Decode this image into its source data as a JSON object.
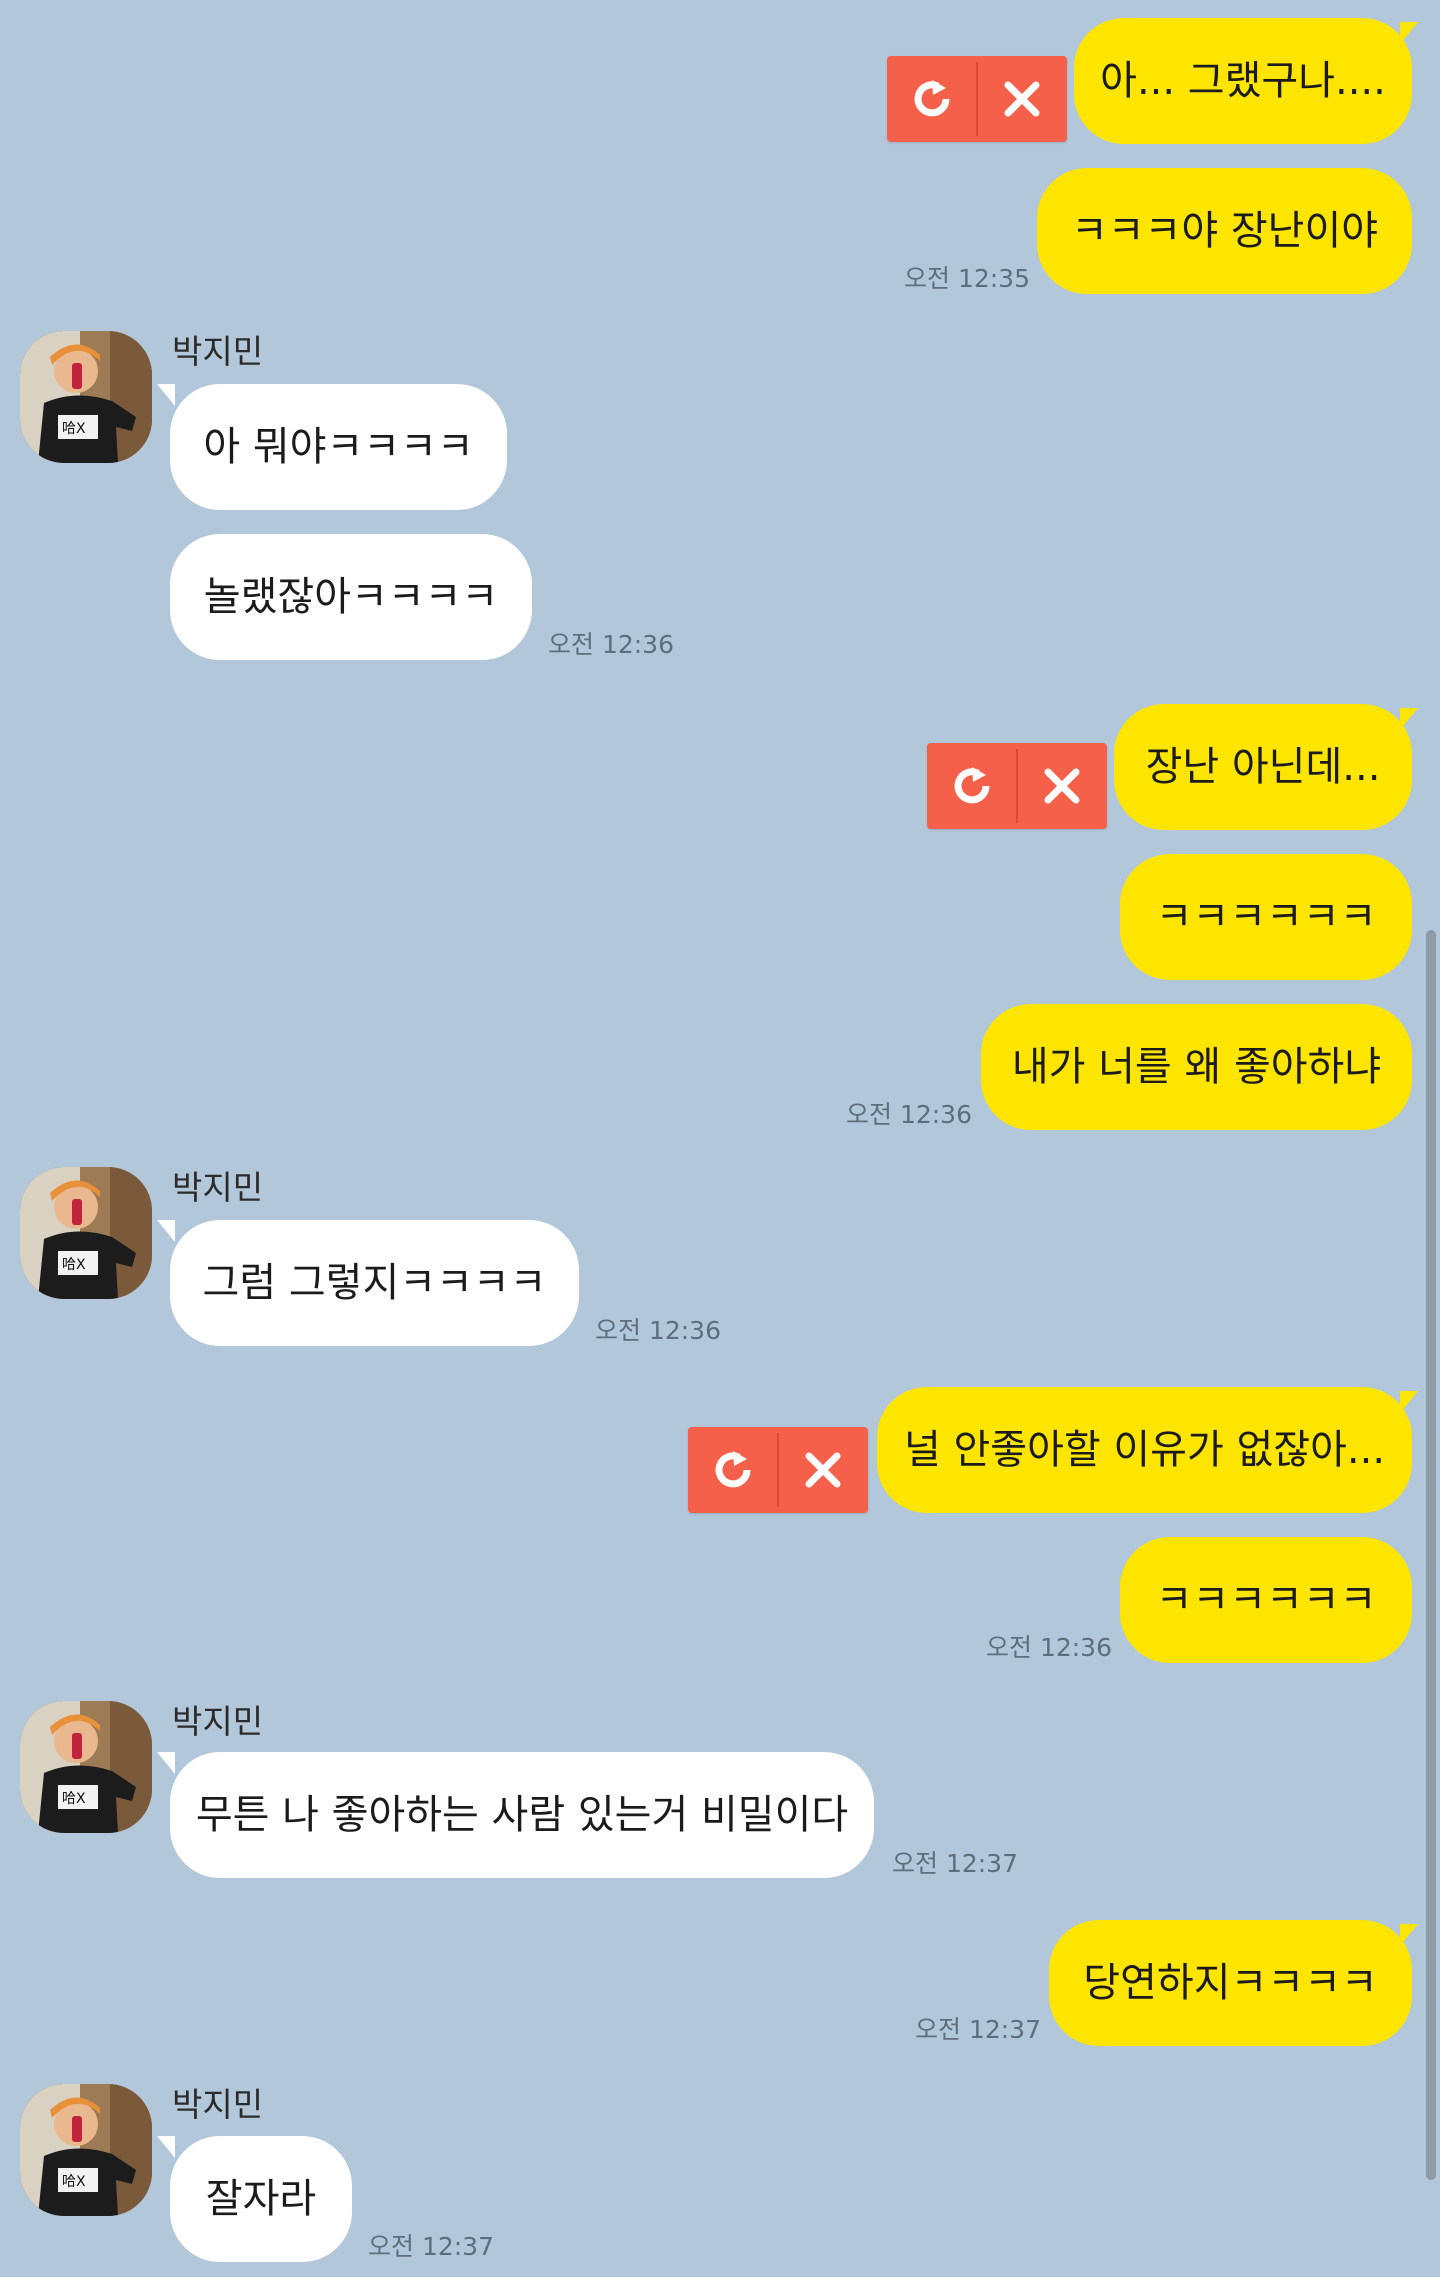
{
  "chat": {
    "friend_name": "박지민",
    "messages": [
      {
        "from": "me",
        "text": "아... 그랬구나...."
      },
      {
        "from": "me",
        "text": "ㅋㅋㅋ야 장난이야",
        "time": "오전 12:35"
      },
      {
        "from": "other",
        "text": "아 뭐야ㅋㅋㅋㅋ"
      },
      {
        "from": "other",
        "text": "놀랬잖아ㅋㅋㅋㅋ",
        "time": "오전 12:36"
      },
      {
        "from": "me",
        "text": "장난 아닌데..."
      },
      {
        "from": "me",
        "text": "ㅋㅋㅋㅋㅋㅋ"
      },
      {
        "from": "me",
        "text": "내가 너를 왜 좋아하냐",
        "time": "오전 12:36"
      },
      {
        "from": "other",
        "text": "그럼 그렇지ㅋㅋㅋㅋ",
        "time": "오전 12:36"
      },
      {
        "from": "me",
        "text": "널 안좋아할 이유가 없잖아..."
      },
      {
        "from": "me",
        "text": "ㅋㅋㅋㅋㅋㅋ",
        "time": "오전 12:36"
      },
      {
        "from": "other",
        "text": "무튼 나 좋아하는 사람 있는거 비밀이다",
        "time": "오전 12:37"
      },
      {
        "from": "me",
        "text": "당연하지ㅋㅋㅋㅋ",
        "time": "오전 12:37"
      },
      {
        "from": "other",
        "text": "잘자라",
        "time": "오전 12:37"
      }
    ]
  },
  "icons": {
    "retry": "retry-icon",
    "delete": "close-icon",
    "avatar": "profile-photo"
  },
  "colors": {
    "background": "#b2c7da",
    "my_bubble": "#fee500",
    "friend_bubble": "#ffffff",
    "failed_send": "#f5604a"
  }
}
